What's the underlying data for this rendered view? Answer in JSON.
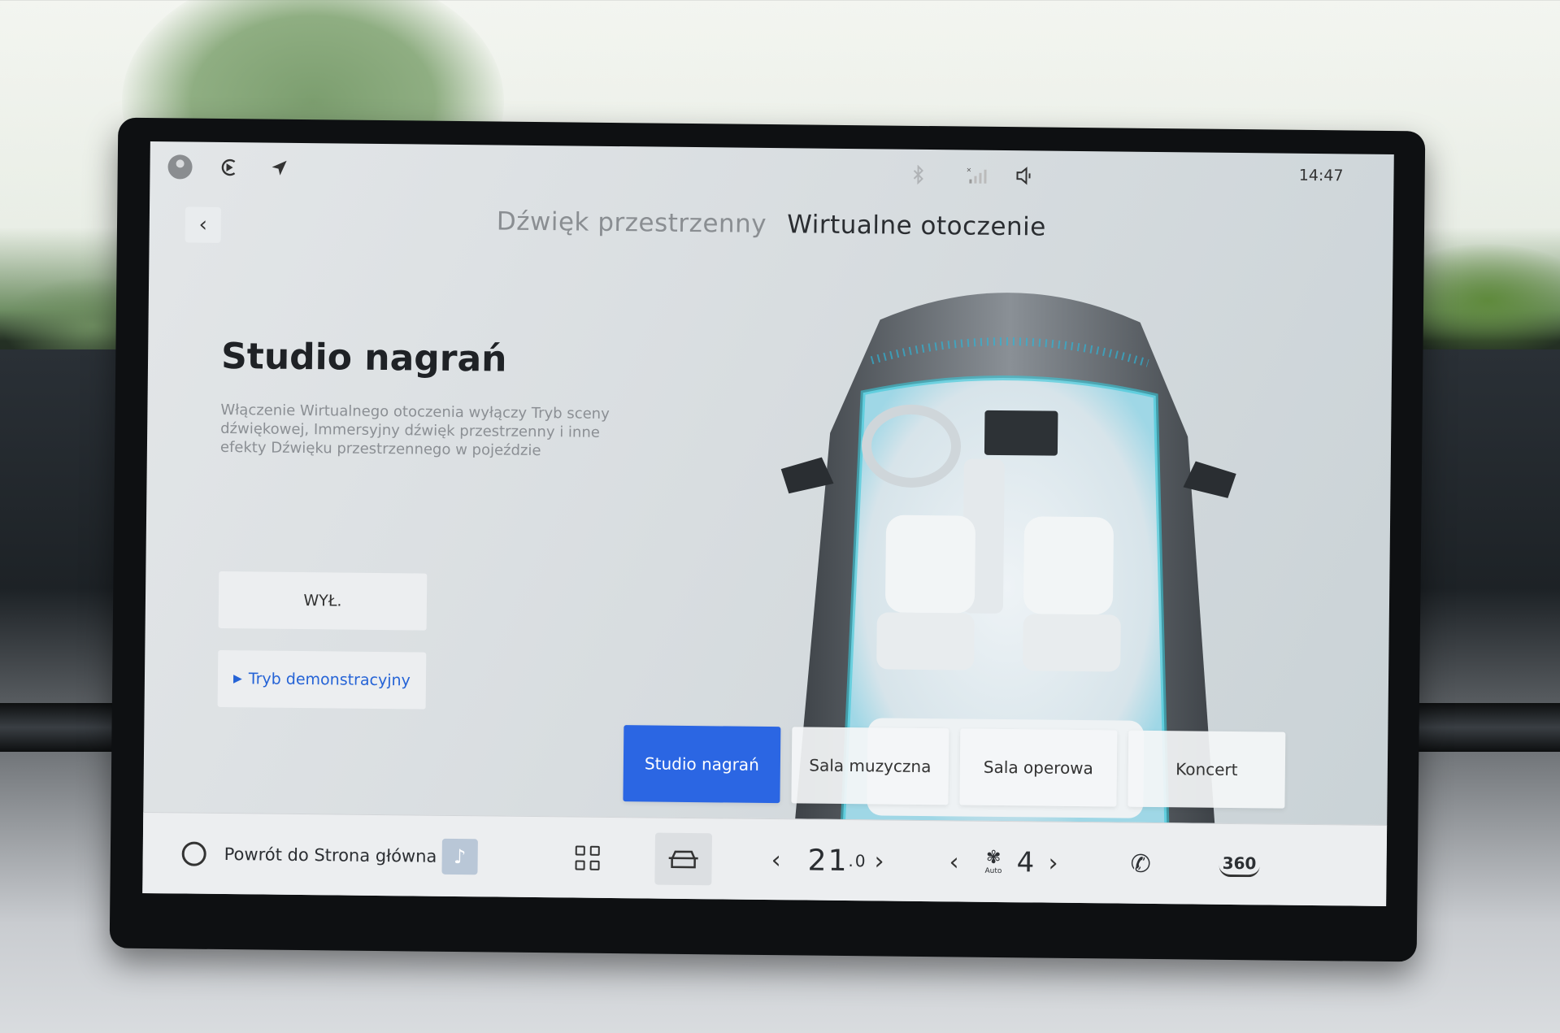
{
  "status_bar": {
    "time": "14:47",
    "icons": [
      "avatar-icon",
      "carplay-icon",
      "navigation-icon",
      "bluetooth-icon",
      "signal-icon",
      "volume-icon"
    ]
  },
  "header": {
    "back_icon": "‹",
    "tabs": [
      {
        "label": "Dźwięk przestrzenny",
        "active": false
      },
      {
        "label": "Wirtualne otoczenie",
        "active": true
      }
    ]
  },
  "main": {
    "title": "Studio nagrań",
    "description": "Włączenie Wirtualnego otoczenia wyłączy Tryb sceny dźwiękowej, Immersyjny dźwięk przestrzenny i inne efekty Dźwięku przestrzennego w pojeździe",
    "off_button": "WYŁ.",
    "demo_button": "Tryb demonstracyjny",
    "demo_icon": "▶"
  },
  "modes": [
    {
      "label": "Studio nagrań",
      "selected": true
    },
    {
      "label": "Sala muzyczna",
      "selected": false
    },
    {
      "label": "Sala operowa",
      "selected": false
    },
    {
      "label": "Koncert",
      "selected": false
    }
  ],
  "dock": {
    "home_label": "Powrót do Strona główna",
    "music_icon": "♪",
    "temp_main": "21",
    "temp_decimal": ".0",
    "fan_level": "4",
    "fan_auto": "Auto",
    "fan_icon": "✾",
    "view_label": "360",
    "chevron_left": "‹",
    "chevron_right": "›",
    "phone_icon": "✆"
  },
  "colors": {
    "accent": "#2b66e3",
    "screen_bg": "#dde1e4",
    "demo_text": "#2563d6"
  }
}
